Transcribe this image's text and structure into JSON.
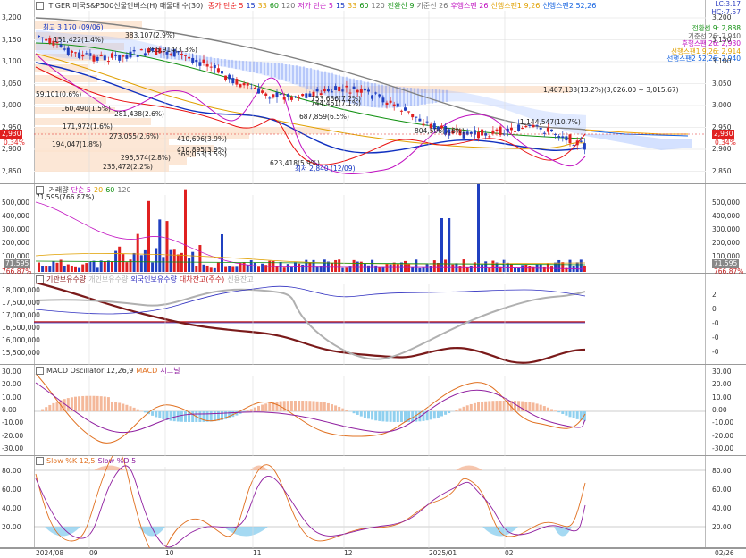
{
  "price_panel": {
    "title": "TIGER 미국S&P500선물인버스(H) 매물대 수(30)",
    "legend": [
      {
        "text": "종가 단순 5",
        "color": "#e81010"
      },
      {
        "text": "15",
        "color": "#1030c0"
      },
      {
        "text": "33",
        "color": "#e0a000"
      },
      {
        "text": "60",
        "color": "#109010"
      },
      {
        "text": "120",
        "color": "#707070"
      },
      {
        "text": "저가 단순 5",
        "color": "#c010c0"
      },
      {
        "text": "15",
        "color": "#1030c0"
      },
      {
        "text": "33",
        "color": "#e0a000"
      },
      {
        "text": "60",
        "color": "#109010"
      },
      {
        "text": "120",
        "color": "#707070"
      },
      {
        "text": "전환선 9",
        "color": "#109010"
      },
      {
        "text": "기준선 26",
        "color": "#707070"
      },
      {
        "text": "후행스팬 26",
        "color": "#c010c0"
      },
      {
        "text": "선행스팬1 9,26",
        "color": "#e0a000"
      },
      {
        "text": "선행스팬2 52,26",
        "color": "#1060e0"
      }
    ],
    "right_legend": [
      {
        "text": "LC:3.17",
        "color": "#3040c0"
      },
      {
        "text": "HC:-7.57",
        "color": "#3040c0"
      },
      {
        "text": "전환선 9: 2,888",
        "color": "#109010"
      },
      {
        "text": "기준선 26: 2,940",
        "color": "#606060"
      },
      {
        "text": "후행스팬 26: 2,930",
        "color": "#c010c0"
      },
      {
        "text": "선행스팬1 9,26: 2,914",
        "color": "#e0a000"
      },
      {
        "text": "선행스팬2 52,26: 2,940",
        "color": "#1060e0"
      }
    ],
    "y_ticks": [
      "3,200",
      "3,150",
      "3,100",
      "3,050",
      "3,000",
      "2,950",
      "2,900",
      "2,850"
    ],
    "y_right_ticks": [
      "3,200",
      "3,150",
      "3,100",
      "3,050",
      "3,000",
      "2,950",
      "2,900",
      "2,850"
    ],
    "current_price": "2,930",
    "current_pct": "0.34%",
    "annotations": [
      "최고 3,170 (09/06)",
      "383,107(2.9%)",
      "151,422(1.4%)",
      "355,914(3.3%)",
      "59,101(0.6%)",
      "160,490(1.5%)",
      "281,438(2.6%)",
      "171,972(1.6%)",
      "273,055(2.6%)",
      "194,047(1.8%)",
      "296,574(2.8%)",
      "235,472(2.2%)",
      "410,696(3.9%)",
      "410,895(3.9%)",
      "369,063(3.5%)",
      "623,418(5.9%)",
      "687,859(6.5%)",
      "753,686(7.2%)",
      "744,461(7.1%)",
      "804,596(7.6%)",
      "1,144,547(10.7%)",
      "1,407,133(13.2%)(3,026.00 ~ 3,015.67)",
      "최저 2,840 (12/09)"
    ]
  },
  "volume_panel": {
    "legend": [
      {
        "text": "거래량",
        "color": "#333"
      },
      {
        "text": "단순 5",
        "color": "#c010c0"
      },
      {
        "text": "20",
        "color": "#e0a000"
      },
      {
        "text": "60",
        "color": "#109010"
      },
      {
        "text": "120",
        "color": "#707070"
      }
    ],
    "sub": "71,595(766.87%)",
    "y_ticks": [
      "500,000",
      "400,000",
      "300,000",
      "200,000",
      "100,000"
    ],
    "current": "71,595",
    "current_pct": "766.87%"
  },
  "investor_panel": {
    "legend": [
      {
        "text": "기관보유수량",
        "color": "#8b1a1a"
      },
      {
        "text": "개인보유수량",
        "color": "#b0b0b0"
      },
      {
        "text": "외국인보유수량",
        "color": "#3030c0"
      },
      {
        "text": "대차잔고(주수)",
        "color": "#c02020"
      },
      {
        "text": "신용잔고",
        "color": "#aaa"
      }
    ],
    "y_ticks": [
      "18,000,000",
      "17,500,000",
      "17,000,000",
      "16,500,000",
      "16,000,000",
      "15,500,000"
    ],
    "y_right_ticks": [
      "2",
      "0",
      "-0",
      "-0",
      "-0"
    ]
  },
  "macd_panel": {
    "legend": [
      {
        "text": "MACD Oscillator 12,26,9",
        "color": "#333"
      },
      {
        "text": "MACD",
        "color": "#e07020"
      },
      {
        "text": "시그널",
        "color": "#9020a0"
      }
    ],
    "y_ticks": [
      "30.00",
      "20.00",
      "10.00",
      "0.00",
      "-10.00",
      "-20.00",
      "-30.00"
    ]
  },
  "stoch_panel": {
    "legend": [
      {
        "text": "Slow %K 12,5",
        "color": "#e07020"
      },
      {
        "text": "Slow %D 5",
        "color": "#9020a0"
      }
    ],
    "y_ticks": [
      "80.00",
      "60.00",
      "40.00",
      "20.00"
    ]
  },
  "x_axis": [
    "2024/08",
    "09",
    "10",
    "11",
    "12",
    "2025/01",
    "02",
    "02/26"
  ]
}
